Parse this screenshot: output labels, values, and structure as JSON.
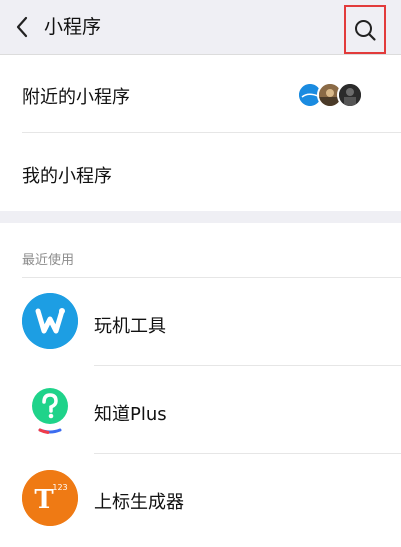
{
  "header": {
    "title": "小程序",
    "back_icon": "chevron-left-icon",
    "search_icon": "search-icon",
    "search_highlight_color": "#e23b3b"
  },
  "nearby": {
    "label": "附近的小程序",
    "avatars": [
      {
        "name": "nearby-app-avatar-1",
        "color": "#1a8be0"
      },
      {
        "name": "nearby-app-avatar-2",
        "color": "#8a6a46"
      },
      {
        "name": "nearby-app-avatar-3",
        "color": "#2b2b2b"
      }
    ]
  },
  "mine": {
    "label": "我的小程序"
  },
  "recent": {
    "caption": "最近使用",
    "apps": [
      {
        "name": "玩机工具",
        "icon": "wanji-tool-icon",
        "color": "#1d9ee3"
      },
      {
        "name": "知道Plus",
        "icon": "zhidao-question-icon",
        "color": "#1fd38a"
      },
      {
        "name": "上标生成器",
        "icon": "superscript-t-icon",
        "color": "#ef7a14",
        "icon_sup": "123"
      }
    ]
  }
}
